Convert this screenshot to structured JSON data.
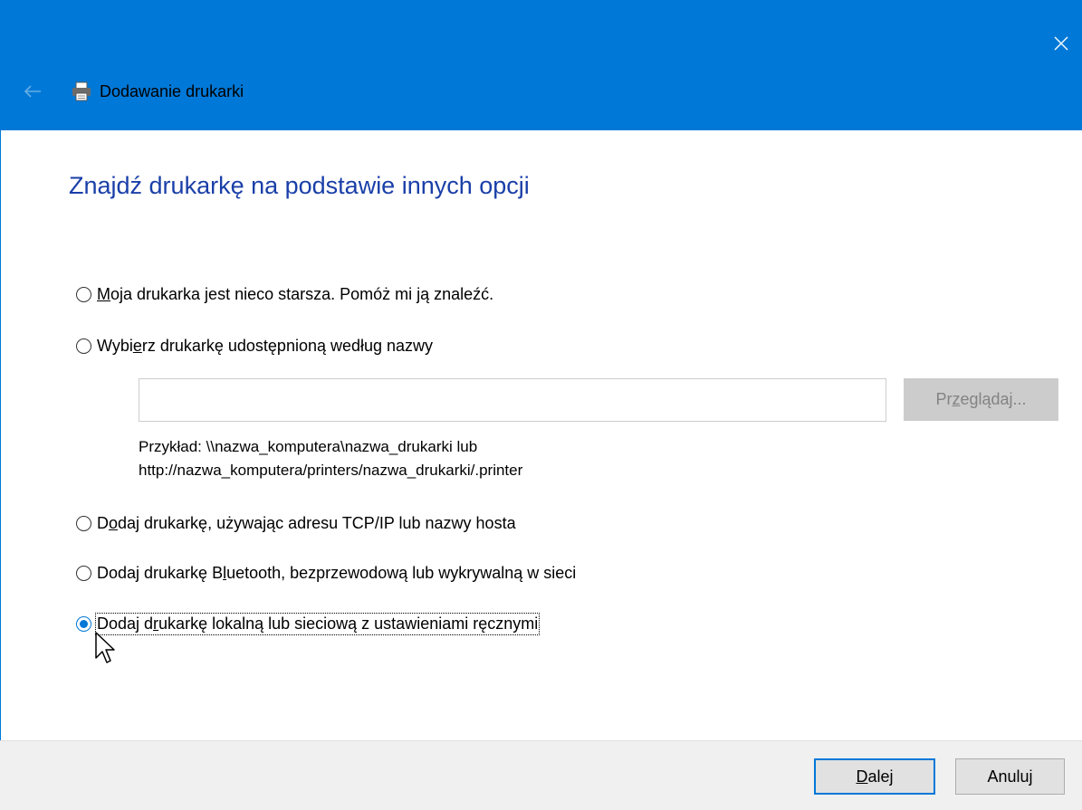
{
  "window": {
    "title": "Dodawanie drukarki",
    "accent_color": "#0078d7",
    "icons": {
      "back": "back-arrow-icon",
      "printer": "printer-icon",
      "close": "close-icon"
    }
  },
  "heading": "Znajdź drukarkę na podstawie innych opcji",
  "options": [
    {
      "pre": "",
      "ul": "M",
      "post": "oja drukarka jest nieco starsza. Pomóż mi ją znaleźć.",
      "checked": false
    },
    {
      "pre": "Wybi",
      "ul": "e",
      "post": "rz drukarkę udostępnioną według nazwy",
      "checked": false
    },
    {
      "pre": "D",
      "ul": "o",
      "post": "daj drukarkę, używając adresu TCP/IP lub nazwy hosta",
      "checked": false
    },
    {
      "pre": "Dodaj drukarkę B",
      "ul": "l",
      "post": "uetooth, bezprzewodową lub wykrywalną w sieci",
      "checked": false
    },
    {
      "pre": "Dodaj d",
      "ul": "r",
      "post": "ukarkę lokalną lub sieciową z ustawieniami ręcznymi",
      "checked": true
    }
  ],
  "share_field": {
    "value": "",
    "placeholder": ""
  },
  "browse_button": {
    "pre": "Pr",
    "ul": "z",
    "post": "eglądaj..."
  },
  "example_lines": [
    "Przykład: \\\\nazwa_komputera\\nazwa_drukarki lub",
    "http://nazwa_komputera/printers/nazwa_drukarki/.printer"
  ],
  "footer": {
    "next": {
      "pre": "",
      "ul": "D",
      "post": "alej"
    },
    "cancel": "Anuluj"
  }
}
